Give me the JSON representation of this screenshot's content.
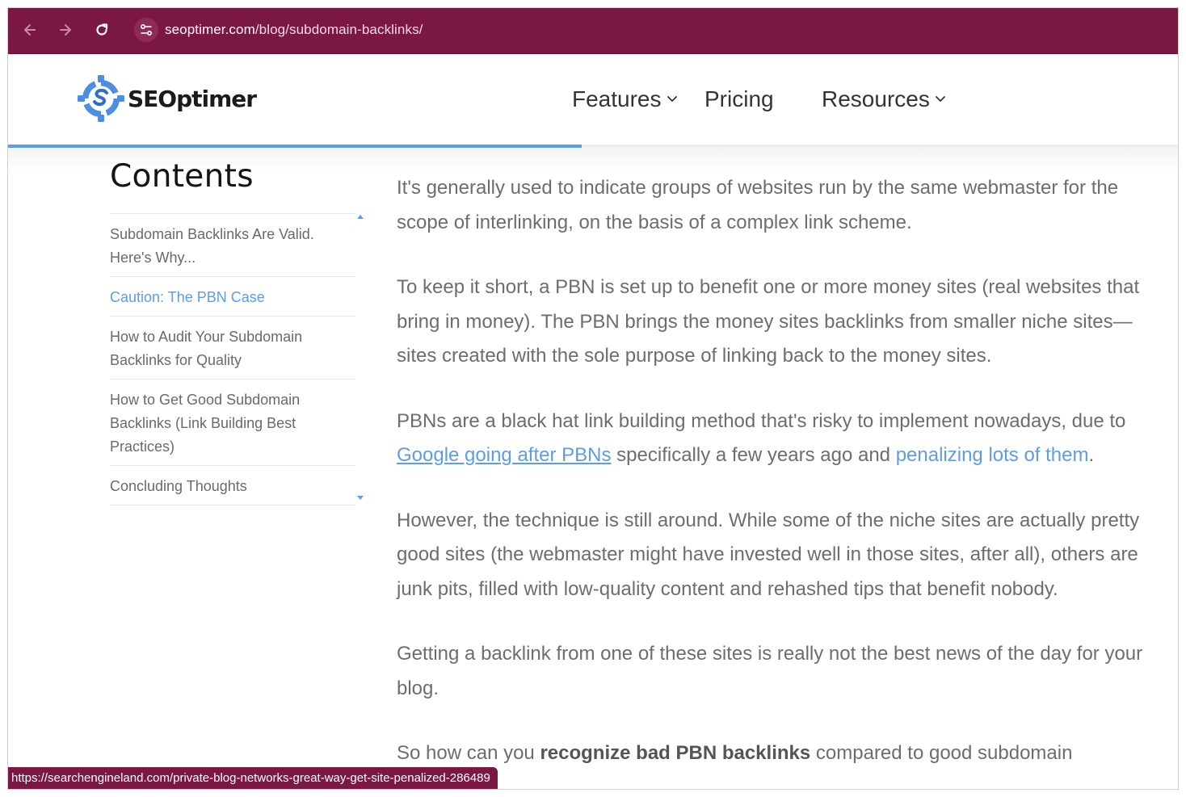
{
  "browser": {
    "url_domain": "seoptimer.com",
    "url_path": "/blog/subdomain-backlinks/"
  },
  "header": {
    "logo_text": "SEOptimer",
    "nav": {
      "features": "Features",
      "pricing": "Pricing",
      "resources": "Resources"
    },
    "reading_progress": 0.49
  },
  "toc": {
    "title": "Contents",
    "items": [
      {
        "label": "Subdomain Backlinks Are Valid. Here's Why..."
      },
      {
        "label": "Caution: The PBN Case"
      },
      {
        "label": "How to Audit Your Subdomain Backlinks for Quality"
      },
      {
        "label": "How to Get Good Subdomain Backlinks (Link Building Best Practices)"
      },
      {
        "label": "Concluding Thoughts"
      }
    ]
  },
  "article": {
    "p1": "It's generally used to indicate groups of websites run by the same webmaster for the scope of interlinking, on the basis of a complex link scheme.",
    "p2": "To keep it short, a PBN is set up to benefit one or more money sites (real websites that bring in money). The PBN brings the money sites backlinks from smaller niche sites—sites created with the sole purpose of linking back to the money sites.",
    "p3_a": "PBNs are a black hat link building method that's risky to implement nowadays, due to ",
    "p3_link1": "Google going after PBNs",
    "p3_b": " specifically a few years ago and ",
    "p3_link2": "penalizing lots of them",
    "p3_c": ".",
    "p4": "However, the technique is still around. While some of the niche sites are actually pretty good sites (the webmaster might have invested well in those sites, after all), others are junk pits, filled with low-quality content and rehashed tips that benefit nobody.",
    "p5": "Getting a backlink from one of these sites is really not the best news of the day for your blog.",
    "p6_a": "So how can you ",
    "p6_bold": "recognize bad PBN backlinks",
    "p6_b": " compared to good subdomain"
  },
  "statusbar": {
    "url": "https://searchengineland.com/private-blog-networks-great-way-get-site-penalized-286489"
  },
  "colors": {
    "browser_bar": "#7b1743",
    "accent": "#5d9ce6",
    "body_text": "#6d6d6d"
  }
}
